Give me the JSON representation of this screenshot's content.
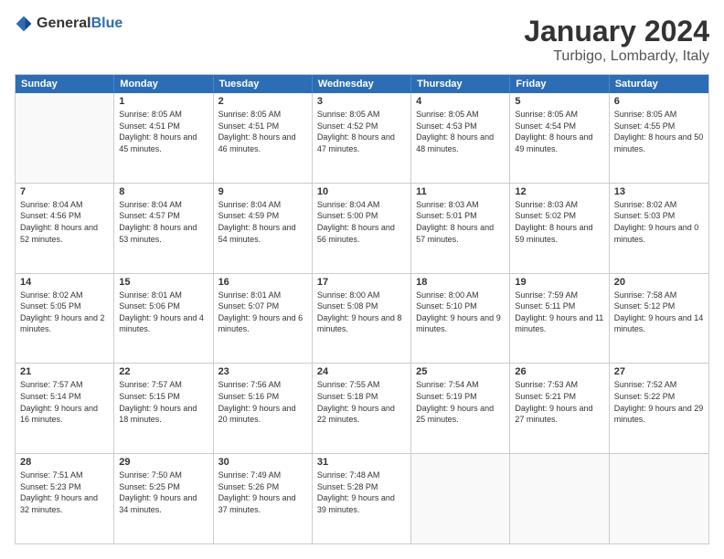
{
  "header": {
    "logo_general": "General",
    "logo_blue": "Blue",
    "month": "January 2024",
    "location": "Turbigo, Lombardy, Italy"
  },
  "days_of_week": [
    "Sunday",
    "Monday",
    "Tuesday",
    "Wednesday",
    "Thursday",
    "Friday",
    "Saturday"
  ],
  "rows": [
    [
      {
        "day": "",
        "sunrise": "",
        "sunset": "",
        "daylight": ""
      },
      {
        "day": "1",
        "sunrise": "Sunrise: 8:05 AM",
        "sunset": "Sunset: 4:51 PM",
        "daylight": "Daylight: 8 hours and 45 minutes."
      },
      {
        "day": "2",
        "sunrise": "Sunrise: 8:05 AM",
        "sunset": "Sunset: 4:51 PM",
        "daylight": "Daylight: 8 hours and 46 minutes."
      },
      {
        "day": "3",
        "sunrise": "Sunrise: 8:05 AM",
        "sunset": "Sunset: 4:52 PM",
        "daylight": "Daylight: 8 hours and 47 minutes."
      },
      {
        "day": "4",
        "sunrise": "Sunrise: 8:05 AM",
        "sunset": "Sunset: 4:53 PM",
        "daylight": "Daylight: 8 hours and 48 minutes."
      },
      {
        "day": "5",
        "sunrise": "Sunrise: 8:05 AM",
        "sunset": "Sunset: 4:54 PM",
        "daylight": "Daylight: 8 hours and 49 minutes."
      },
      {
        "day": "6",
        "sunrise": "Sunrise: 8:05 AM",
        "sunset": "Sunset: 4:55 PM",
        "daylight": "Daylight: 8 hours and 50 minutes."
      }
    ],
    [
      {
        "day": "7",
        "sunrise": "Sunrise: 8:04 AM",
        "sunset": "Sunset: 4:56 PM",
        "daylight": "Daylight: 8 hours and 52 minutes."
      },
      {
        "day": "8",
        "sunrise": "Sunrise: 8:04 AM",
        "sunset": "Sunset: 4:57 PM",
        "daylight": "Daylight: 8 hours and 53 minutes."
      },
      {
        "day": "9",
        "sunrise": "Sunrise: 8:04 AM",
        "sunset": "Sunset: 4:59 PM",
        "daylight": "Daylight: 8 hours and 54 minutes."
      },
      {
        "day": "10",
        "sunrise": "Sunrise: 8:04 AM",
        "sunset": "Sunset: 5:00 PM",
        "daylight": "Daylight: 8 hours and 56 minutes."
      },
      {
        "day": "11",
        "sunrise": "Sunrise: 8:03 AM",
        "sunset": "Sunset: 5:01 PM",
        "daylight": "Daylight: 8 hours and 57 minutes."
      },
      {
        "day": "12",
        "sunrise": "Sunrise: 8:03 AM",
        "sunset": "Sunset: 5:02 PM",
        "daylight": "Daylight: 8 hours and 59 minutes."
      },
      {
        "day": "13",
        "sunrise": "Sunrise: 8:02 AM",
        "sunset": "Sunset: 5:03 PM",
        "daylight": "Daylight: 9 hours and 0 minutes."
      }
    ],
    [
      {
        "day": "14",
        "sunrise": "Sunrise: 8:02 AM",
        "sunset": "Sunset: 5:05 PM",
        "daylight": "Daylight: 9 hours and 2 minutes."
      },
      {
        "day": "15",
        "sunrise": "Sunrise: 8:01 AM",
        "sunset": "Sunset: 5:06 PM",
        "daylight": "Daylight: 9 hours and 4 minutes."
      },
      {
        "day": "16",
        "sunrise": "Sunrise: 8:01 AM",
        "sunset": "Sunset: 5:07 PM",
        "daylight": "Daylight: 9 hours and 6 minutes."
      },
      {
        "day": "17",
        "sunrise": "Sunrise: 8:00 AM",
        "sunset": "Sunset: 5:08 PM",
        "daylight": "Daylight: 9 hours and 8 minutes."
      },
      {
        "day": "18",
        "sunrise": "Sunrise: 8:00 AM",
        "sunset": "Sunset: 5:10 PM",
        "daylight": "Daylight: 9 hours and 9 minutes."
      },
      {
        "day": "19",
        "sunrise": "Sunrise: 7:59 AM",
        "sunset": "Sunset: 5:11 PM",
        "daylight": "Daylight: 9 hours and 11 minutes."
      },
      {
        "day": "20",
        "sunrise": "Sunrise: 7:58 AM",
        "sunset": "Sunset: 5:12 PM",
        "daylight": "Daylight: 9 hours and 14 minutes."
      }
    ],
    [
      {
        "day": "21",
        "sunrise": "Sunrise: 7:57 AM",
        "sunset": "Sunset: 5:14 PM",
        "daylight": "Daylight: 9 hours and 16 minutes."
      },
      {
        "day": "22",
        "sunrise": "Sunrise: 7:57 AM",
        "sunset": "Sunset: 5:15 PM",
        "daylight": "Daylight: 9 hours and 18 minutes."
      },
      {
        "day": "23",
        "sunrise": "Sunrise: 7:56 AM",
        "sunset": "Sunset: 5:16 PM",
        "daylight": "Daylight: 9 hours and 20 minutes."
      },
      {
        "day": "24",
        "sunrise": "Sunrise: 7:55 AM",
        "sunset": "Sunset: 5:18 PM",
        "daylight": "Daylight: 9 hours and 22 minutes."
      },
      {
        "day": "25",
        "sunrise": "Sunrise: 7:54 AM",
        "sunset": "Sunset: 5:19 PM",
        "daylight": "Daylight: 9 hours and 25 minutes."
      },
      {
        "day": "26",
        "sunrise": "Sunrise: 7:53 AM",
        "sunset": "Sunset: 5:21 PM",
        "daylight": "Daylight: 9 hours and 27 minutes."
      },
      {
        "day": "27",
        "sunrise": "Sunrise: 7:52 AM",
        "sunset": "Sunset: 5:22 PM",
        "daylight": "Daylight: 9 hours and 29 minutes."
      }
    ],
    [
      {
        "day": "28",
        "sunrise": "Sunrise: 7:51 AM",
        "sunset": "Sunset: 5:23 PM",
        "daylight": "Daylight: 9 hours and 32 minutes."
      },
      {
        "day": "29",
        "sunrise": "Sunrise: 7:50 AM",
        "sunset": "Sunset: 5:25 PM",
        "daylight": "Daylight: 9 hours and 34 minutes."
      },
      {
        "day": "30",
        "sunrise": "Sunrise: 7:49 AM",
        "sunset": "Sunset: 5:26 PM",
        "daylight": "Daylight: 9 hours and 37 minutes."
      },
      {
        "day": "31",
        "sunrise": "Sunrise: 7:48 AM",
        "sunset": "Sunset: 5:28 PM",
        "daylight": "Daylight: 9 hours and 39 minutes."
      },
      {
        "day": "",
        "sunrise": "",
        "sunset": "",
        "daylight": ""
      },
      {
        "day": "",
        "sunrise": "",
        "sunset": "",
        "daylight": ""
      },
      {
        "day": "",
        "sunrise": "",
        "sunset": "",
        "daylight": ""
      }
    ]
  ]
}
